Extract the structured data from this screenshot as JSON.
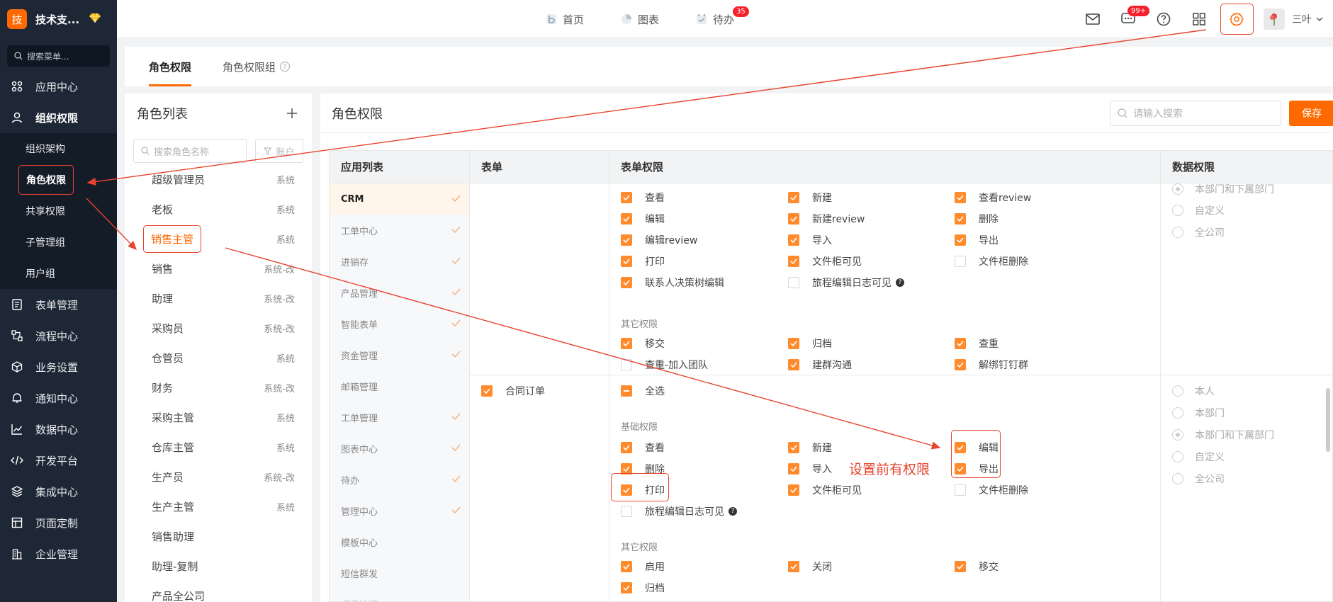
{
  "brand": {
    "logo": "技",
    "name": "技术支..."
  },
  "sidebar": {
    "search_placeholder": "搜索菜单...",
    "items": [
      {
        "label": "应用中心",
        "icon": "apps-icon"
      },
      {
        "label": "组织权限",
        "icon": "user-icon"
      },
      {
        "label": "表单管理",
        "icon": "form-icon"
      },
      {
        "label": "流程中心",
        "icon": "flow-icon"
      },
      {
        "label": "业务设置",
        "icon": "cube-icon"
      },
      {
        "label": "通知中心",
        "icon": "bell-icon"
      },
      {
        "label": "数据中心",
        "icon": "chart-icon"
      },
      {
        "label": "开发平台",
        "icon": "code-icon"
      },
      {
        "label": "集成中心",
        "icon": "layers-icon"
      },
      {
        "label": "页面定制",
        "icon": "layout-icon"
      },
      {
        "label": "企业管理",
        "icon": "building-icon"
      }
    ],
    "sub_items": [
      "组织架构",
      "角色权限",
      "共享权限",
      "子管理组",
      "用户组"
    ]
  },
  "topnav": {
    "home": "首页",
    "charts": "图表",
    "todo": "待办",
    "todo_badge": "35",
    "msg_badge": "99+",
    "user": "三叶"
  },
  "tabs": [
    "角色权限",
    "角色权限组"
  ],
  "role_panel": {
    "title": "角色列表",
    "search_placeholder": "搜索角色名称",
    "filter_label": "账户",
    "roles": [
      {
        "name": "超级管理员",
        "tag": "系统"
      },
      {
        "name": "老板",
        "tag": "系统"
      },
      {
        "name": "销售主管",
        "tag": "系统"
      },
      {
        "name": "销售",
        "tag": "系统-改"
      },
      {
        "name": "助理",
        "tag": "系统-改"
      },
      {
        "name": "采购员",
        "tag": "系统-改"
      },
      {
        "name": "仓管员",
        "tag": "系统"
      },
      {
        "name": "财务",
        "tag": "系统-改"
      },
      {
        "name": "采购主管",
        "tag": "系统"
      },
      {
        "name": "仓库主管",
        "tag": "系统"
      },
      {
        "name": "生产员",
        "tag": "系统-改"
      },
      {
        "name": "生产主管",
        "tag": "系统"
      },
      {
        "name": "销售助理",
        "tag": ""
      },
      {
        "name": "助理-复制",
        "tag": ""
      },
      {
        "name": "产品全公司",
        "tag": ""
      }
    ]
  },
  "main": {
    "title": "角色权限",
    "search_placeholder": "请输入搜索",
    "save": "保存",
    "col_apps": "应用列表",
    "col_forms": "表单",
    "col_perms": "表单权限",
    "col_data": "数据权限",
    "apps": [
      {
        "name": "CRM",
        "checked": true
      },
      {
        "name": "工单中心",
        "checked": true
      },
      {
        "name": "进销存",
        "checked": true
      },
      {
        "name": "产品管理",
        "checked": true
      },
      {
        "name": "智能表单",
        "checked": true
      },
      {
        "name": "资金管理",
        "checked": true
      },
      {
        "name": "邮箱管理",
        "checked": false
      },
      {
        "name": "工单管理",
        "checked": true
      },
      {
        "name": "图表中心",
        "checked": true
      },
      {
        "name": "待办",
        "checked": true
      },
      {
        "name": "管理中心",
        "checked": true
      },
      {
        "name": "模板中心",
        "checked": false
      },
      {
        "name": "短信群发",
        "checked": false
      },
      {
        "name": "项目管理",
        "checked": false
      }
    ],
    "section1": {
      "perms": [
        {
          "label": "查看",
          "on": true
        },
        {
          "label": "新建",
          "on": true
        },
        {
          "label": "查看review",
          "on": true
        },
        {
          "label": "编辑",
          "on": true
        },
        {
          "label": "新建review",
          "on": true
        },
        {
          "label": "删除",
          "on": true
        },
        {
          "label": "编辑review",
          "on": true
        },
        {
          "label": "导入",
          "on": true
        },
        {
          "label": "导出",
          "on": true
        },
        {
          "label": "打印",
          "on": true
        },
        {
          "label": "文件柜可见",
          "on": true
        },
        {
          "label": "文件柜删除",
          "on": false
        },
        {
          "label": "联系人决策树编辑",
          "on": true
        },
        {
          "label": "旅程编辑日志可见",
          "on": false,
          "help": true
        }
      ],
      "other_label": "其它权限",
      "other": [
        {
          "label": "移交",
          "on": true
        },
        {
          "label": "归档",
          "on": true
        },
        {
          "label": "查重",
          "on": true
        },
        {
          "label": "查重-加入团队",
          "on": false
        },
        {
          "label": "建群沟通",
          "on": true
        },
        {
          "label": "解绑钉钉群",
          "on": true
        }
      ],
      "data": [
        "本部门和下属部门",
        "自定义",
        "全公司"
      ]
    },
    "section2": {
      "form": "合同订单",
      "select_all": "全选",
      "basic_label": "基础权限",
      "perms": [
        {
          "label": "查看",
          "on": true
        },
        {
          "label": "新建",
          "on": true
        },
        {
          "label": "编辑",
          "on": true
        },
        {
          "label": "删除",
          "on": true
        },
        {
          "label": "导入",
          "on": true
        },
        {
          "label": "导出",
          "on": true
        },
        {
          "label": "打印",
          "on": true
        },
        {
          "label": "文件柜可见",
          "on": true
        },
        {
          "label": "文件柜删除",
          "on": false
        },
        {
          "label": "旅程编辑日志可见",
          "on": false,
          "help": true
        }
      ],
      "other_label": "其它权限",
      "other": [
        {
          "label": "启用",
          "on": true
        },
        {
          "label": "关闭",
          "on": true
        },
        {
          "label": "移交",
          "on": true
        },
        {
          "label": "归档",
          "on": true
        }
      ],
      "data": [
        "本人",
        "本部门",
        "本部门和下属部门",
        "自定义",
        "全公司"
      ]
    }
  },
  "annotation": "设置前有权限",
  "colors": {
    "accent": "#ff6a00",
    "sidebar": "#1d2735",
    "annotation": "#e8432d"
  }
}
